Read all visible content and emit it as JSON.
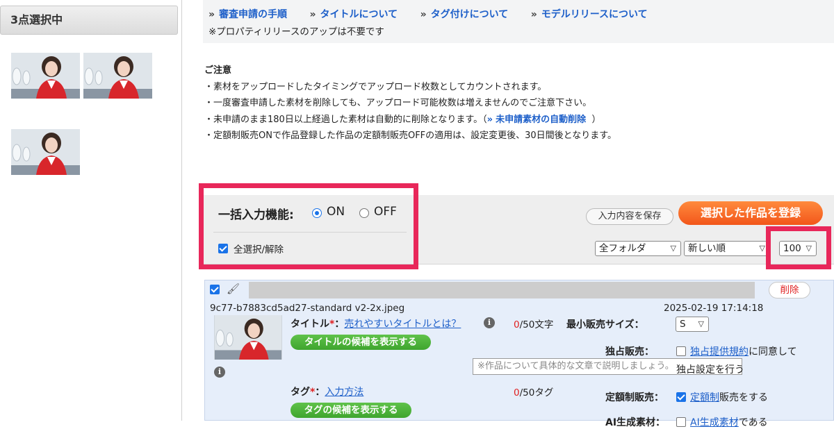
{
  "sidebar": {
    "selected_count_label": "3点選択中",
    "thumbnails": [
      {
        "alt": "flight-attendant-photo"
      },
      {
        "alt": "flight-attendant-photo"
      },
      {
        "alt": "flight-attendant-photo"
      }
    ]
  },
  "info": {
    "links": [
      {
        "arrow": "»",
        "label": "審査申請の手順"
      },
      {
        "arrow": "»",
        "label": "タイトルについて"
      },
      {
        "arrow": "»",
        "label": "タグ付けについて"
      },
      {
        "arrow": "»",
        "label": "モデルリリースについて"
      }
    ],
    "note": "※プロパティリリースのアップは不要です"
  },
  "caution": {
    "title": "ご注意",
    "line1": "・素材をアップロードしたタイミングでアップロード枚数としてカウントされます。",
    "line2": "・一度審査申請した素材を削除しても、アップロード可能枚数は増えませんのでご注意下さい。",
    "line3_pre": "・未申請のまま180日以上経過した素材は自動的に削除となります。（",
    "line3_arrow": "»",
    "line3_link": "未申請素材の自動削除",
    "line3_post": "）",
    "line4": "・定額制販売ONで作品登録した作品の定額制販売OFFの適用は、設定変更後、30日間後となります。"
  },
  "bulk": {
    "label": "一括入力機能:",
    "on_label": "ON",
    "off_label": "OFF",
    "selected": "ON",
    "select_all_label": "全選択/解除",
    "select_all_checked": true
  },
  "actions": {
    "save_label": "入力内容を保存",
    "register_label": "選択した作品を登録"
  },
  "filters": {
    "folder": "全フォルダ",
    "sort": "新しい順",
    "per_page": "100"
  },
  "item": {
    "filename": "9c77-b7883cd5ad27-standard v2-2x.jpeg",
    "timestamp": "2025-02-19 17:14:18",
    "delete_label": "削除",
    "title_label": "タイトル",
    "required_mark": "*",
    "colon": "：",
    "title_help_link": "売れやすいタイトルとは？",
    "title_count": "0",
    "title_limit": "/50文字",
    "title_suggest_button": "タイトルの候補を表示する",
    "description_placeholder": "※作品について具体的な文章で説明しましょう。",
    "tag_label": "タグ",
    "tag_help_link": "入力方法",
    "tag_count": "0",
    "tag_limit": "/50タグ",
    "tag_suggest_button": "タグの候補を表示する",
    "min_size_label": "最小販売サイズ：",
    "min_size_value": "S",
    "exclusive_label": "独占販売：",
    "exclusive_link": "独占提供規約",
    "exclusive_text1": "に同意して",
    "exclusive_text2": "独占設定を行う",
    "exclusive_checked": false,
    "subscription_label": "定額制販売：",
    "subscription_link": "定額制",
    "subscription_text": "販売をする",
    "subscription_checked": true,
    "ai_label": "AI生成素材：",
    "ai_link": "AI生成素材",
    "ai_text": "である"
  },
  "colors": {
    "accent_blue": "#1d5fc9",
    "highlight": "#e8275a",
    "register_orange": "#f2561a",
    "suggest_green": "#3fa52e",
    "item_bg": "#e6eefa"
  }
}
